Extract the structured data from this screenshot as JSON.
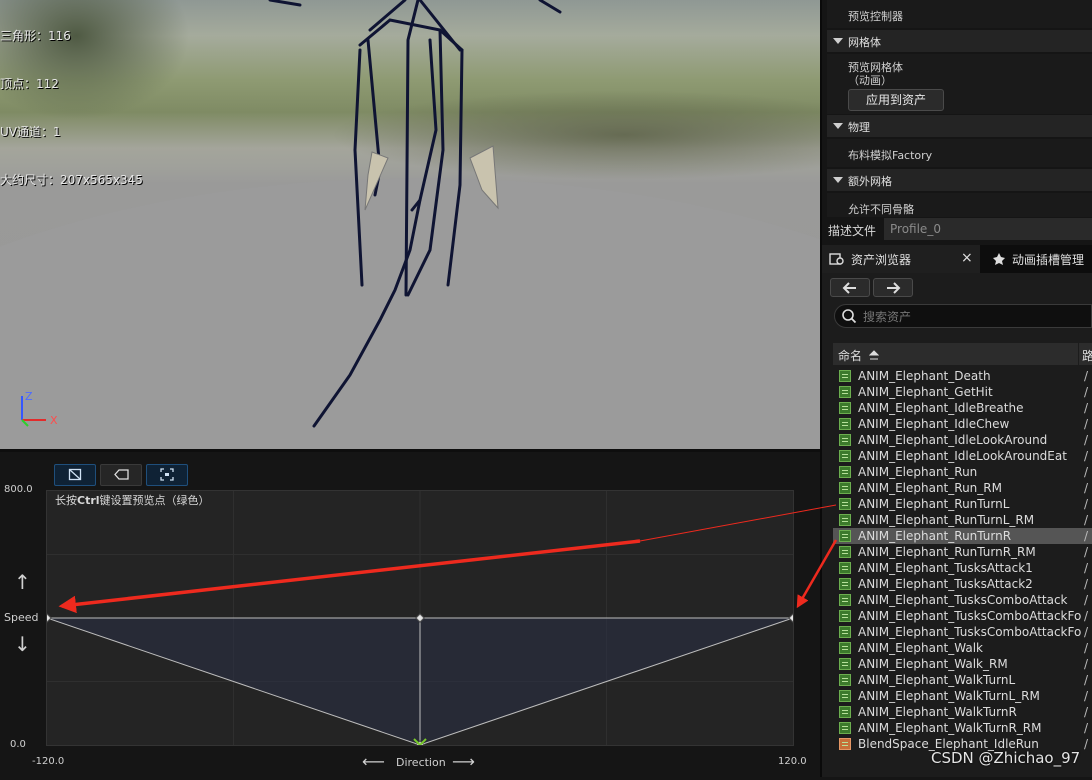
{
  "viewport": {
    "stats": [
      "三角形：116",
      "顶点：112",
      "UV通道：1",
      "大约尺寸：207x565x345"
    ],
    "axis_labels": {
      "z": "Z",
      "x": "X"
    }
  },
  "blendspace": {
    "hint_prefix": "长按",
    "hint_key": "Ctrl",
    "hint_suffix": "键设置预览点（绿色）",
    "y_axis": {
      "label": "Speed",
      "min": "0.0",
      "max": "800.0",
      "up_arrow": "↑",
      "down_arrow": "↓"
    },
    "x_axis": {
      "label": "Direction",
      "min": "-120.0",
      "max": "120.0",
      "left_arrow": "⟵",
      "right_arrow": "⟶"
    },
    "samples": [
      {
        "direction": -120,
        "speed": 400
      },
      {
        "direction": 0,
        "speed": 400
      },
      {
        "direction": 120,
        "speed": 400
      },
      {
        "direction": 0,
        "speed": 0
      }
    ],
    "preview_point": {
      "direction": 0,
      "speed": 0
    },
    "accent_color": "#2a5d8f",
    "preview_color": "#7acb2c"
  },
  "details": {
    "preview_controller": "预览控制器",
    "cat_mesh": "网格体",
    "preview_mesh_line1": "预览网格体",
    "preview_mesh_line2": "（动画）",
    "apply_to_asset": "应用到资产",
    "cat_physics": "物理",
    "cloth_factory": "布料模拟Factory",
    "cat_extra_mesh": "额外网格",
    "allow_diff_skeleton": "允许不同骨骼",
    "profile_label": "描述文件",
    "profile_value": "Profile_0"
  },
  "asset_browser": {
    "tab_label": "资产浏览器",
    "tab_close": "×",
    "tab2_label": "动画插槽管理",
    "search_placeholder": "搜索资产",
    "col_name": "命名",
    "col_path": "路",
    "path_stub": "/",
    "selected_index": 10,
    "items": [
      "ANIM_Elephant_Death",
      "ANIM_Elephant_GetHit",
      "ANIM_Elephant_IdleBreathe",
      "ANIM_Elephant_IdleChew",
      "ANIM_Elephant_IdleLookAround",
      "ANIM_Elephant_IdleLookAroundEat",
      "ANIM_Elephant_Run",
      "ANIM_Elephant_Run_RM",
      "ANIM_Elephant_RunTurnL",
      "ANIM_Elephant_RunTurnL_RM",
      "ANIM_Elephant_RunTurnR",
      "ANIM_Elephant_RunTurnR_RM",
      "ANIM_Elephant_TusksAttack1",
      "ANIM_Elephant_TusksAttack2",
      "ANIM_Elephant_TusksComboAttack",
      "ANIM_Elephant_TusksComboAttackFo",
      "ANIM_Elephant_TusksComboAttackFo",
      "ANIM_Elephant_Walk",
      "ANIM_Elephant_Walk_RM",
      "ANIM_Elephant_WalkTurnL",
      "ANIM_Elephant_WalkTurnL_RM",
      "ANIM_Elephant_WalkTurnR",
      "ANIM_Elephant_WalkTurnR_RM",
      "BlendSpace_Elephant_IdleRun"
    ]
  },
  "watermark": "CSDN @Zhichao_97",
  "annotation_color": "#ee2a1e"
}
